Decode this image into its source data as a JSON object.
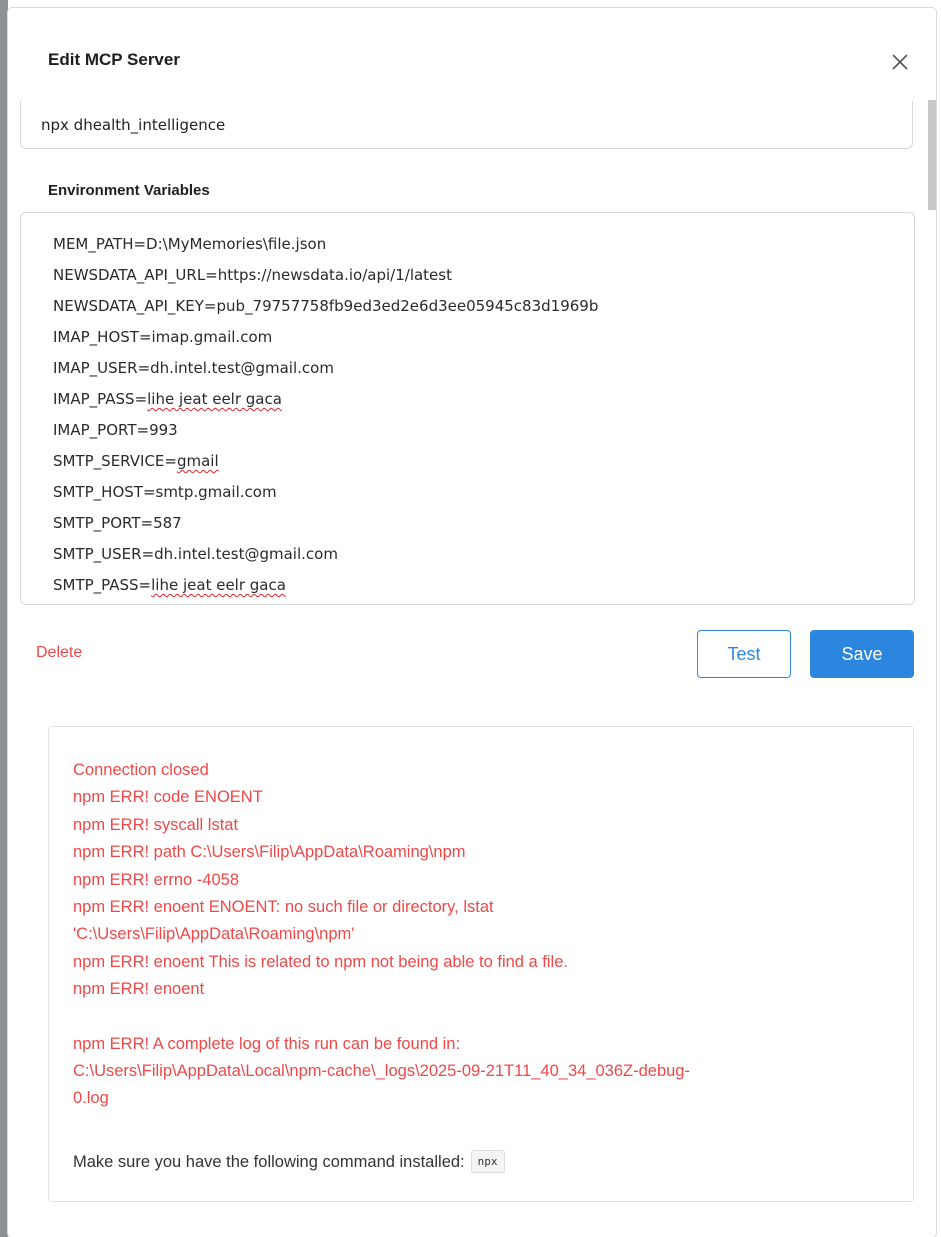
{
  "modal": {
    "title": "Edit MCP Server"
  },
  "command": {
    "value": "npx dhealth_intelligence"
  },
  "env": {
    "label": "Environment Variables",
    "lines": [
      {
        "text": "MEM_PATH=D:\\MyMemories\\file.json"
      },
      {
        "text": "NEWSDATA_API_URL=https://newsdata.io/api/1/latest"
      },
      {
        "text": "NEWSDATA_API_KEY=pub_79757758fb9ed3ed2e6d3ee05945c83d1969b"
      },
      {
        "text": "IMAP_HOST=imap.gmail.com"
      },
      {
        "text": "IMAP_USER=dh.intel.test@gmail.com"
      },
      {
        "prefix": "IMAP_PASS=",
        "flagged": "lihe jeat eelr gaca"
      },
      {
        "text": "IMAP_PORT=993"
      },
      {
        "prefix": "SMTP_SERVICE=",
        "flagged": "gmail"
      },
      {
        "text": "SMTP_HOST=smtp.gmail.com"
      },
      {
        "text": "SMTP_PORT=587"
      },
      {
        "text": "SMTP_USER=dh.intel.test@gmail.com"
      },
      {
        "prefix": "SMTP_PASS=",
        "flagged": "lihe jeat eelr gaca"
      }
    ]
  },
  "actions": {
    "delete_label": "Delete",
    "test_label": "Test",
    "save_label": "Save"
  },
  "log": {
    "lines": [
      "Connection closed",
      "npm ERR! code ENOENT",
      "npm ERR! syscall lstat",
      "npm ERR! path C:\\Users\\Filip\\AppData\\Roaming\\npm",
      "npm ERR! errno -4058",
      "npm ERR! enoent ENOENT: no such file or directory, lstat",
      "'C:\\Users\\Filip\\AppData\\Roaming\\npm'",
      "npm ERR! enoent This is related to npm not being able to find a file.",
      "npm ERR! enoent",
      "",
      "npm ERR! A complete log of this run can be found in:",
      "C:\\Users\\Filip\\AppData\\Local\\npm-cache\\_logs\\2025-09-21T11_40_34_036Z-debug-",
      "0.log"
    ],
    "hint": "Make sure you have the following command installed:",
    "command_chip": "npx"
  },
  "colors": {
    "primary": "#2c86e0",
    "error": "#f04848",
    "delete": "#ee4a4a"
  },
  "icons": {
    "close": "close-icon"
  }
}
